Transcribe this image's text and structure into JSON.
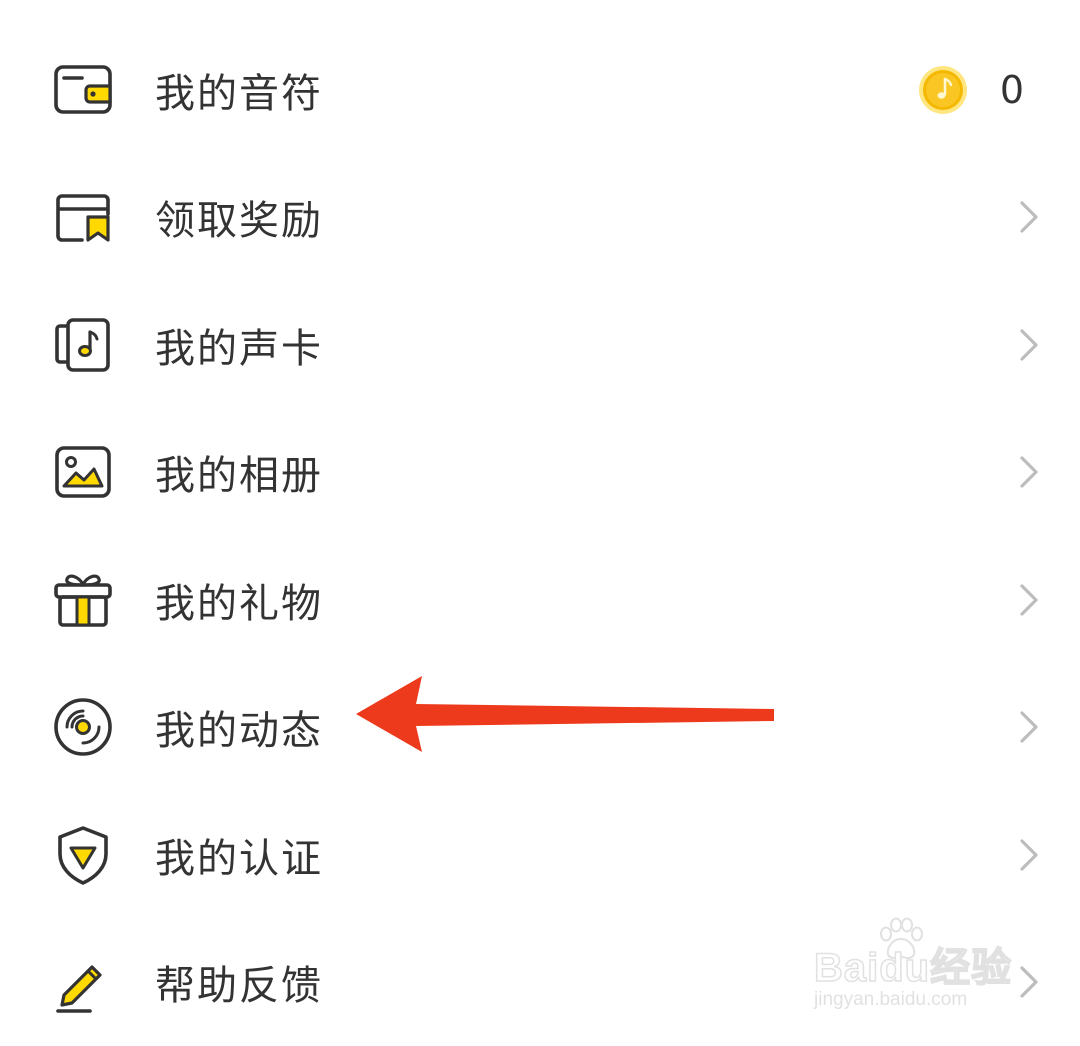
{
  "menu": {
    "items": [
      {
        "label": "我的音符",
        "icon": "wallet-icon",
        "trailing": "coin-count"
      },
      {
        "label": "领取奖励",
        "icon": "reward-bookmark-icon",
        "trailing": "chevron"
      },
      {
        "label": "我的声卡",
        "icon": "voice-card-icon",
        "trailing": "chevron"
      },
      {
        "label": "我的相册",
        "icon": "photo-album-icon",
        "trailing": "chevron"
      },
      {
        "label": "我的礼物",
        "icon": "gift-icon",
        "trailing": "chevron"
      },
      {
        "label": "我的动态",
        "icon": "vinyl-record-icon",
        "trailing": "chevron"
      },
      {
        "label": "我的认证",
        "icon": "verified-shield-icon",
        "trailing": "chevron"
      },
      {
        "label": "帮助反馈",
        "icon": "pencil-feedback-icon",
        "trailing": "chevron"
      }
    ],
    "coin": {
      "icon": "music-note-coin-icon",
      "count": "0"
    }
  },
  "annotation": {
    "icon": "red-arrow-pointer",
    "points_to": "我的动态"
  },
  "watermark": {
    "brand": "Baidu经验",
    "url": "jingyan.baidu.com"
  },
  "colors": {
    "accent_yellow": "#FFD900",
    "icon_stroke": "#333333",
    "text": "#333333",
    "chevron": "#bdbdbd",
    "arrow_red": "#EE3A1C",
    "coin_gold": "#F5B800"
  }
}
